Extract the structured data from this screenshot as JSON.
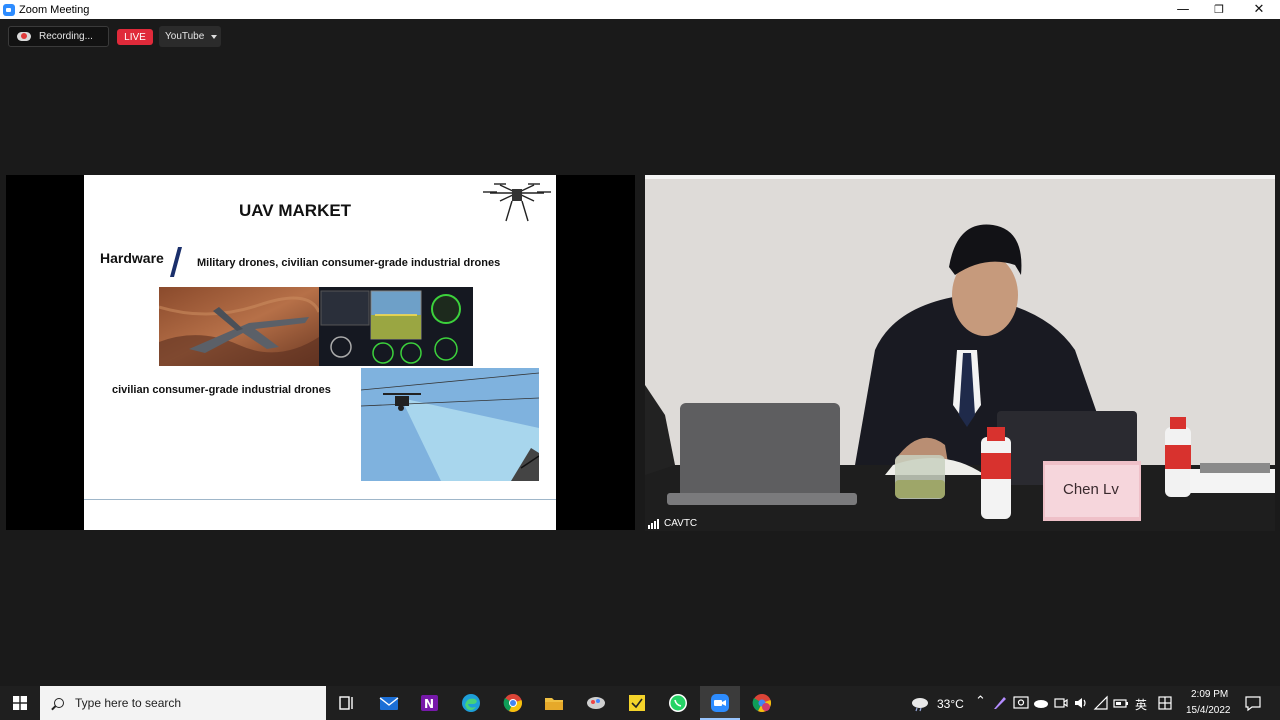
{
  "window": {
    "title": "Zoom Meeting",
    "minimize": "—",
    "restore": "❐",
    "close": "✕"
  },
  "status": {
    "recording_label": "Recording...",
    "live_label": "LIVE",
    "stream_target": "YouTube"
  },
  "slide": {
    "title": "UAV MARKET",
    "section": "Hardware",
    "section_subtitle": "Military drones, civilian consumer-grade industrial drones",
    "caption": "civilian consumer-grade industrial drones"
  },
  "video": {
    "participant_name": "CAVTC",
    "name_card": "Chen Lv"
  },
  "taskbar": {
    "search_placeholder": "Type here to search",
    "temperature": "33°C",
    "ime": "英",
    "time": "2:09 PM",
    "date": "15/4/2022"
  },
  "colors": {
    "live_red": "#e02a3a",
    "zoom_blue": "#2d8cff",
    "slide_accent": "#1a2f6b"
  }
}
